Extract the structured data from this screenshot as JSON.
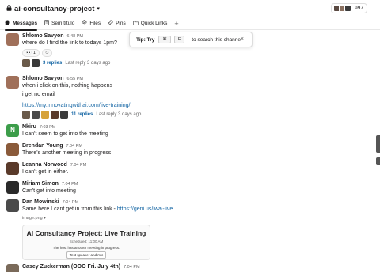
{
  "header": {
    "channel_icon": "lock-icon",
    "channel_name": "ai-consultancy-project",
    "member_count": "997",
    "member_avatar_colors": [
      "#5a4a42",
      "#8a7060",
      "#3a3a3a"
    ]
  },
  "tabs": [
    {
      "label": "Messages",
      "icon": "message-icon",
      "active": true
    },
    {
      "label": "Sem título",
      "icon": "document-icon",
      "active": false
    },
    {
      "label": "Files",
      "icon": "files-icon",
      "active": false
    },
    {
      "label": "Pins",
      "icon": "pin-icon",
      "active": false
    },
    {
      "label": "Quick Links",
      "icon": "folder-icon",
      "active": false
    }
  ],
  "tab_add": "+",
  "tip": {
    "strong": "Tip: Try",
    "key1": "⌘",
    "key2": "F",
    "text": "to search this channel",
    "close": "×"
  },
  "messages": [
    {
      "sender": "Shlomo Savyon",
      "time": "6:48 PM",
      "lines": [
        "where do I find the link to todays 1pm?"
      ],
      "reaction": {
        "emoji": "👀",
        "count": "1"
      },
      "replies": "3 replies",
      "last_reply": "Last reply 3 days ago",
      "avatar_color": "#a0705a"
    },
    {
      "sender": "Shlomo Savyon",
      "time": "6:55 PM",
      "lines": [
        "when i click on this, nothing happens",
        "i get no email"
      ],
      "link": "https://my.innovatingwithai.com/live-training/",
      "replies": "11 replies",
      "last_reply": "Last reply 3 days ago",
      "avatar_color": "#a0705a"
    },
    {
      "sender": "Nkiru",
      "time": "7:03 PM",
      "text": "I can't seem to get into the meeting",
      "avatar_letter": "N",
      "avatar_color": "#3c9d4a"
    },
    {
      "sender": "Brendan Young",
      "time": "7:04 PM",
      "text": "There's another meeting in progress",
      "avatar_color": "#8a5a3a"
    },
    {
      "sender": "Leanna Norwood",
      "time": "7:04 PM",
      "text": "I can't get in either.",
      "avatar_color": "#5a3a2a"
    },
    {
      "sender": "Miriam Simon",
      "time": "7:04 PM",
      "text": "Can't get into meeting",
      "avatar_color": "#2a2a2a"
    },
    {
      "sender": "Dan Mowinski",
      "time": "7:04 PM",
      "text": "Same here I cant get in from this link - ",
      "link": "https://geni.us/iwai-live",
      "attachment": "image.png",
      "avatar_color": "#4a4a4a"
    },
    {
      "sender": "Casey Zuckerman (OOO Fri. July 4th)",
      "time": "7:04 PM",
      "avatar_color": "#7a6a5a"
    }
  ],
  "preview": {
    "title": "AI Consultancy Project: Live Training",
    "scheduled": "Scheduled: 11:00 AM",
    "host": "The host has another meeting in progress.",
    "button": "Test speaker and mic"
  },
  "thread_avatar_colors_1": [
    "#6a5a4a",
    "#3a3a3a"
  ],
  "thread_avatar_colors_2": [
    "#6a5a4a",
    "#4a4a4a",
    "#d6a23a",
    "#5a3a2a",
    "#3a3a3a"
  ]
}
